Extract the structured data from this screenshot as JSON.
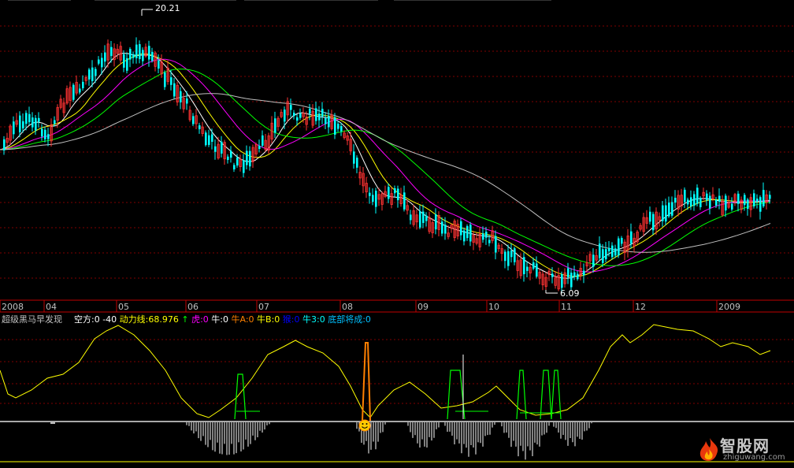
{
  "price_panel": {
    "high_label": "20.21",
    "low_label": "6.09"
  },
  "time_axis": [
    "2008",
    "04",
    "05",
    "06",
    "07",
    "08",
    "09",
    "10",
    "11",
    "12",
    "2009"
  ],
  "indicator": {
    "name": "超级黑马早发现",
    "items": [
      {
        "label": "空方:0",
        "color": "#ffffff"
      },
      {
        "label": "-40",
        "color": "#ffffff"
      },
      {
        "label": "动力线:68.976",
        "color": "#ffff00"
      },
      {
        "label": "↑",
        "color": "#00ff00"
      },
      {
        "label": "虎:0",
        "color": "#ff00ff"
      },
      {
        "label": "牛:0",
        "color": "#ffffff"
      },
      {
        "label": "牛A:0",
        "color": "#ff8000"
      },
      {
        "label": "牛B:0",
        "color": "#ffff00"
      },
      {
        "label": "猴:0",
        "color": "#0000ff"
      },
      {
        "label": "牛3:0",
        "color": "#00ffff"
      },
      {
        "label": "底部将成:0",
        "color": "#00c0ff"
      }
    ]
  },
  "watermark": {
    "title": "智股网",
    "url": "zhiguwang.com"
  },
  "colors": {
    "up": "#ff3333",
    "down": "#00ffff",
    "ma5": "#ffffff",
    "ma10": "#ffff00",
    "ma20": "#ff00ff",
    "ma30": "#00ff00",
    "ma60": "#c0c0c0",
    "grid": "#800000",
    "power_line": "#ffff00",
    "signal": "#00ff00",
    "spike": "#ff8000"
  }
}
